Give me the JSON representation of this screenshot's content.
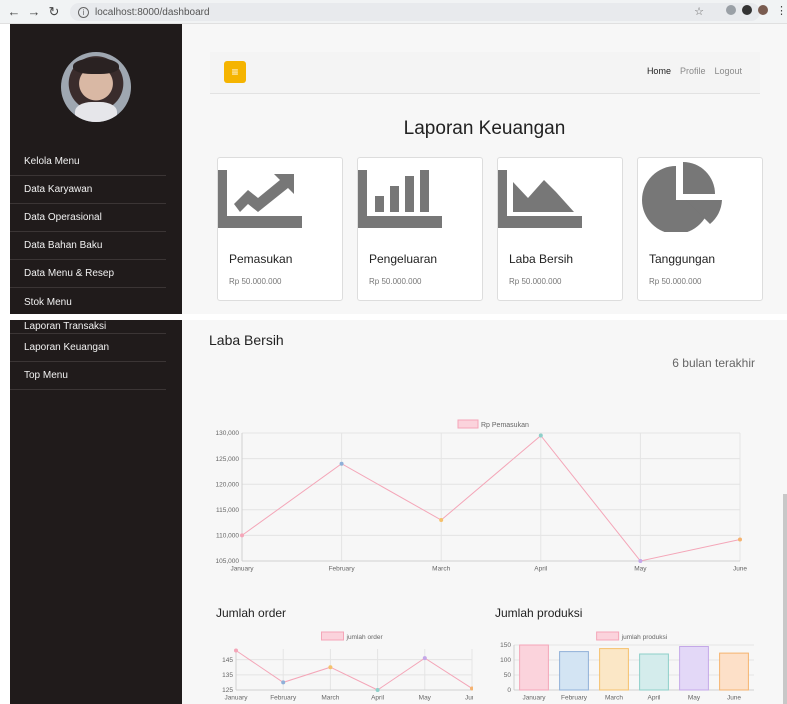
{
  "browser": {
    "url": "localhost:8000/dashboard"
  },
  "sidebar": {
    "items": [
      {
        "label": "Kelola Menu"
      },
      {
        "label": "Data Karyawan"
      },
      {
        "label": "Data Operasional"
      },
      {
        "label": "Data Bahan Baku"
      },
      {
        "label": "Data Menu & Resep"
      },
      {
        "label": "Stok Menu"
      },
      {
        "label": "Laporan Transaksi"
      },
      {
        "label": "Laporan Keuangan"
      },
      {
        "label": "Top Menu"
      }
    ]
  },
  "topbar": {
    "menu_icon": "hamburger-icon",
    "nav": [
      {
        "label": "Home",
        "active": true
      },
      {
        "label": "Profile",
        "active": false
      },
      {
        "label": "Logout",
        "active": false
      }
    ]
  },
  "page": {
    "title": "Laporan Keuangan"
  },
  "cards": [
    {
      "title": "Pemasukan",
      "value": "Rp 50.000.000",
      "icon": "line-chart-icon"
    },
    {
      "title": "Pengeluaran",
      "value": "Rp 50.000.000",
      "icon": "bar-chart-icon"
    },
    {
      "title": "Laba Bersih",
      "value": "Rp 50.000.000",
      "icon": "area-chart-icon"
    },
    {
      "title": "Tanggungan",
      "value": "Rp 50.000.000",
      "icon": "pie-chart-icon"
    }
  ],
  "laba": {
    "title": "Laba Bersih",
    "period": "6 bulan terakhir"
  },
  "orders": {
    "title": "Jumlah order"
  },
  "produksi": {
    "title": "Jumlah produksi"
  },
  "colors": {
    "sidebar_bg": "#201b1b",
    "accent": "#f5b400",
    "line": "#f4a6b8",
    "card_icon": "#777777"
  },
  "chart_data": [
    {
      "type": "line",
      "categories": [
        "January",
        "February",
        "March",
        "April",
        "May",
        "June"
      ],
      "series": [
        {
          "name": "Rp Pemasukan",
          "values": [
            110000,
            124000,
            113000,
            129500,
            105000,
            109200
          ]
        }
      ],
      "point_colors": [
        "#f4a6b8",
        "#8fb0d8",
        "#f5c16c",
        "#8ecfc9",
        "#c4a8e8",
        "#f5b36f"
      ],
      "yticks": [
        "105,000",
        "110,000",
        "115,000",
        "120,000",
        "125,000",
        "130,000"
      ],
      "ylim": [
        105000,
        130000
      ],
      "grid": true,
      "legend": "top"
    },
    {
      "type": "line",
      "categories": [
        "January",
        "February",
        "March",
        "April",
        "May",
        "June"
      ],
      "series": [
        {
          "name": "jumlah order",
          "values": [
            151,
            130,
            140,
            125,
            146,
            126
          ]
        }
      ],
      "point_colors": [
        "#f4a6b8",
        "#8fb0d8",
        "#f5c16c",
        "#8ecfc9",
        "#c4a8e8",
        "#f5b36f"
      ],
      "yticks": [
        "125",
        "135",
        "145"
      ],
      "ylim": [
        125,
        152
      ],
      "grid": true,
      "legend": "top"
    },
    {
      "type": "bar",
      "categories": [
        "January",
        "February",
        "March",
        "April",
        "May",
        "June"
      ],
      "series": [
        {
          "name": "jumlah produksi",
          "values": [
            150,
            128,
            138,
            120,
            145,
            123
          ]
        }
      ],
      "bar_fills": [
        "#fbd3dc",
        "#d3e4f3",
        "#fbe7c6",
        "#d4ecec",
        "#e3d8f7",
        "#fde0c8"
      ],
      "bar_strokes": [
        "#f4a6b8",
        "#8fb0d8",
        "#f5c16c",
        "#8ecfc9",
        "#c4a8e8",
        "#f5b36f"
      ],
      "yticks": [
        "0",
        "50",
        "100",
        "150"
      ],
      "ylim": [
        0,
        150
      ],
      "grid": true,
      "legend": "top"
    }
  ]
}
